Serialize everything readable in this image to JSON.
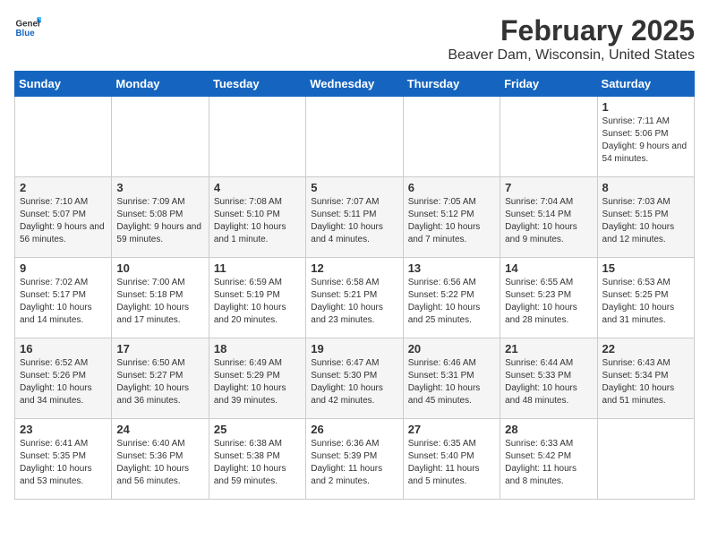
{
  "header": {
    "logo_general": "General",
    "logo_blue": "Blue",
    "title": "February 2025",
    "subtitle": "Beaver Dam, Wisconsin, United States"
  },
  "calendar": {
    "days_of_week": [
      "Sunday",
      "Monday",
      "Tuesday",
      "Wednesday",
      "Thursday",
      "Friday",
      "Saturday"
    ],
    "weeks": [
      [
        {
          "day": "",
          "info": ""
        },
        {
          "day": "",
          "info": ""
        },
        {
          "day": "",
          "info": ""
        },
        {
          "day": "",
          "info": ""
        },
        {
          "day": "",
          "info": ""
        },
        {
          "day": "",
          "info": ""
        },
        {
          "day": "1",
          "info": "Sunrise: 7:11 AM\nSunset: 5:06 PM\nDaylight: 9 hours and 54 minutes."
        }
      ],
      [
        {
          "day": "2",
          "info": "Sunrise: 7:10 AM\nSunset: 5:07 PM\nDaylight: 9 hours and 56 minutes."
        },
        {
          "day": "3",
          "info": "Sunrise: 7:09 AM\nSunset: 5:08 PM\nDaylight: 9 hours and 59 minutes."
        },
        {
          "day": "4",
          "info": "Sunrise: 7:08 AM\nSunset: 5:10 PM\nDaylight: 10 hours and 1 minute."
        },
        {
          "day": "5",
          "info": "Sunrise: 7:07 AM\nSunset: 5:11 PM\nDaylight: 10 hours and 4 minutes."
        },
        {
          "day": "6",
          "info": "Sunrise: 7:05 AM\nSunset: 5:12 PM\nDaylight: 10 hours and 7 minutes."
        },
        {
          "day": "7",
          "info": "Sunrise: 7:04 AM\nSunset: 5:14 PM\nDaylight: 10 hours and 9 minutes."
        },
        {
          "day": "8",
          "info": "Sunrise: 7:03 AM\nSunset: 5:15 PM\nDaylight: 10 hours and 12 minutes."
        }
      ],
      [
        {
          "day": "9",
          "info": "Sunrise: 7:02 AM\nSunset: 5:17 PM\nDaylight: 10 hours and 14 minutes."
        },
        {
          "day": "10",
          "info": "Sunrise: 7:00 AM\nSunset: 5:18 PM\nDaylight: 10 hours and 17 minutes."
        },
        {
          "day": "11",
          "info": "Sunrise: 6:59 AM\nSunset: 5:19 PM\nDaylight: 10 hours and 20 minutes."
        },
        {
          "day": "12",
          "info": "Sunrise: 6:58 AM\nSunset: 5:21 PM\nDaylight: 10 hours and 23 minutes."
        },
        {
          "day": "13",
          "info": "Sunrise: 6:56 AM\nSunset: 5:22 PM\nDaylight: 10 hours and 25 minutes."
        },
        {
          "day": "14",
          "info": "Sunrise: 6:55 AM\nSunset: 5:23 PM\nDaylight: 10 hours and 28 minutes."
        },
        {
          "day": "15",
          "info": "Sunrise: 6:53 AM\nSunset: 5:25 PM\nDaylight: 10 hours and 31 minutes."
        }
      ],
      [
        {
          "day": "16",
          "info": "Sunrise: 6:52 AM\nSunset: 5:26 PM\nDaylight: 10 hours and 34 minutes."
        },
        {
          "day": "17",
          "info": "Sunrise: 6:50 AM\nSunset: 5:27 PM\nDaylight: 10 hours and 36 minutes."
        },
        {
          "day": "18",
          "info": "Sunrise: 6:49 AM\nSunset: 5:29 PM\nDaylight: 10 hours and 39 minutes."
        },
        {
          "day": "19",
          "info": "Sunrise: 6:47 AM\nSunset: 5:30 PM\nDaylight: 10 hours and 42 minutes."
        },
        {
          "day": "20",
          "info": "Sunrise: 6:46 AM\nSunset: 5:31 PM\nDaylight: 10 hours and 45 minutes."
        },
        {
          "day": "21",
          "info": "Sunrise: 6:44 AM\nSunset: 5:33 PM\nDaylight: 10 hours and 48 minutes."
        },
        {
          "day": "22",
          "info": "Sunrise: 6:43 AM\nSunset: 5:34 PM\nDaylight: 10 hours and 51 minutes."
        }
      ],
      [
        {
          "day": "23",
          "info": "Sunrise: 6:41 AM\nSunset: 5:35 PM\nDaylight: 10 hours and 53 minutes."
        },
        {
          "day": "24",
          "info": "Sunrise: 6:40 AM\nSunset: 5:36 PM\nDaylight: 10 hours and 56 minutes."
        },
        {
          "day": "25",
          "info": "Sunrise: 6:38 AM\nSunset: 5:38 PM\nDaylight: 10 hours and 59 minutes."
        },
        {
          "day": "26",
          "info": "Sunrise: 6:36 AM\nSunset: 5:39 PM\nDaylight: 11 hours and 2 minutes."
        },
        {
          "day": "27",
          "info": "Sunrise: 6:35 AM\nSunset: 5:40 PM\nDaylight: 11 hours and 5 minutes."
        },
        {
          "day": "28",
          "info": "Sunrise: 6:33 AM\nSunset: 5:42 PM\nDaylight: 11 hours and 8 minutes."
        },
        {
          "day": "",
          "info": ""
        }
      ]
    ]
  }
}
